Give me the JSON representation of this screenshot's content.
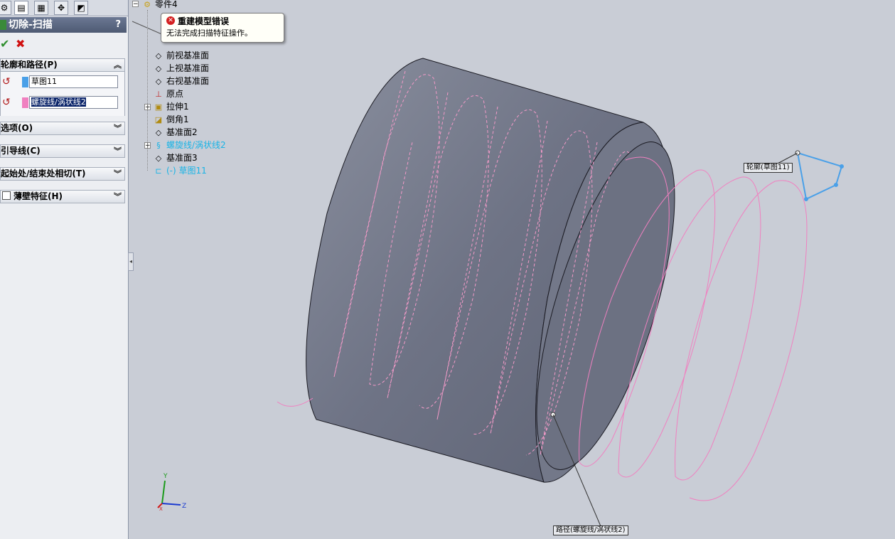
{
  "property_manager": {
    "title": "切除-扫描",
    "help": "?",
    "ok_icon": "check-icon",
    "cancel_icon": "close-icon",
    "groups": {
      "profile_path": "轮廓和路径(P)",
      "options": "选项(O)",
      "guide_curves": "引导线(C)",
      "tangency": "起始处/结束处相切(T)",
      "thin_feature": "薄壁特征(H)"
    },
    "profile_value": "草图11",
    "path_value": "螺旋线/涡状线2",
    "profile_color": "#4aa0e8",
    "path_color": "#f080c0"
  },
  "feature_tree": {
    "root": "零件4",
    "items": [
      {
        "label": "前视基准面"
      },
      {
        "label": "上视基准面"
      },
      {
        "label": "右视基准面"
      },
      {
        "label": "原点"
      },
      {
        "label": "拉伸1"
      },
      {
        "label": "倒角1"
      },
      {
        "label": "基准面2"
      },
      {
        "label": "螺旋线/涡状线2"
      },
      {
        "label": "基准面3"
      },
      {
        "label": "(-) 草图11"
      }
    ]
  },
  "error_tooltip": {
    "title": "重建模型错误",
    "message": "无法完成扫描特征操作。"
  },
  "viewport": {
    "profile_callout": "轮廓(草图11)",
    "path_callout": "路径(螺旋线/涡状线2)",
    "triad_y": "Y",
    "triad_z": "Z",
    "triad_x": "X"
  }
}
